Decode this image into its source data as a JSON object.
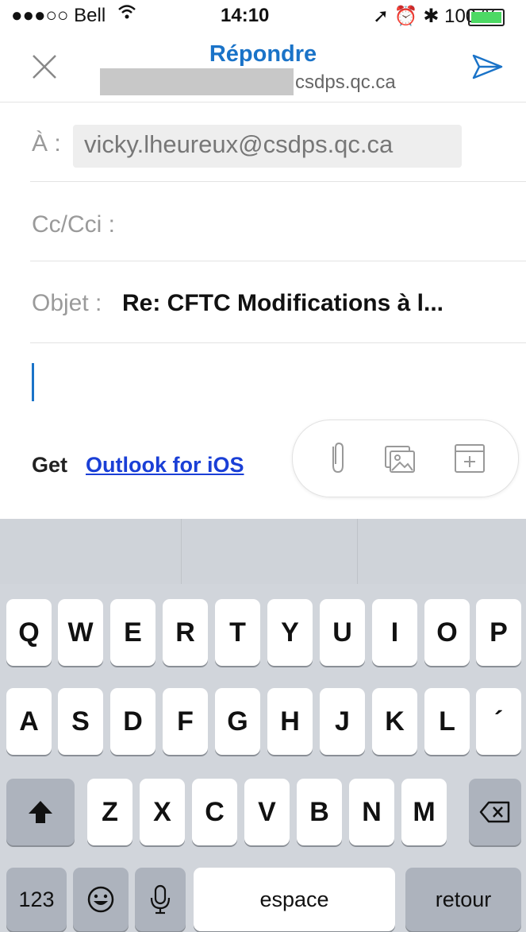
{
  "status_bar": {
    "carrier": "●●●○○ Bell",
    "time": "14:10",
    "right_icons": "➚ ⏰ ✱ 100 %"
  },
  "nav": {
    "title": "Répondre",
    "account_domain": "csdps.qc.ca"
  },
  "fields": {
    "to_label": "À :",
    "to_value": "vicky.lheureux@csdps.qc.ca",
    "cc_label": "Cc/Cci :",
    "subject_label": "Objet :",
    "subject_value": "Re: CFTC  Modifications à l..."
  },
  "body": {
    "signature_prefix": "Get",
    "signature_link": "Outlook for iOS"
  },
  "keyboard": {
    "row1": [
      "Q",
      "W",
      "E",
      "R",
      "T",
      "Y",
      "U",
      "I",
      "O",
      "P"
    ],
    "row2": [
      "A",
      "S",
      "D",
      "F",
      "G",
      "H",
      "J",
      "K",
      "L",
      "´"
    ],
    "row3": [
      "Z",
      "X",
      "C",
      "V",
      "B",
      "N",
      "M"
    ],
    "numbers_key": "123",
    "space_key": "espace",
    "return_key": "retour"
  },
  "colors": {
    "accent": "#1a73c8",
    "link": "#1a3fd6",
    "battery": "#4cd964"
  },
  "icons": [
    "close-icon",
    "send-icon",
    "attachment-icon",
    "photo-icon",
    "calendar-icon",
    "shift-icon",
    "backspace-icon",
    "emoji-icon",
    "microphone-icon"
  ]
}
